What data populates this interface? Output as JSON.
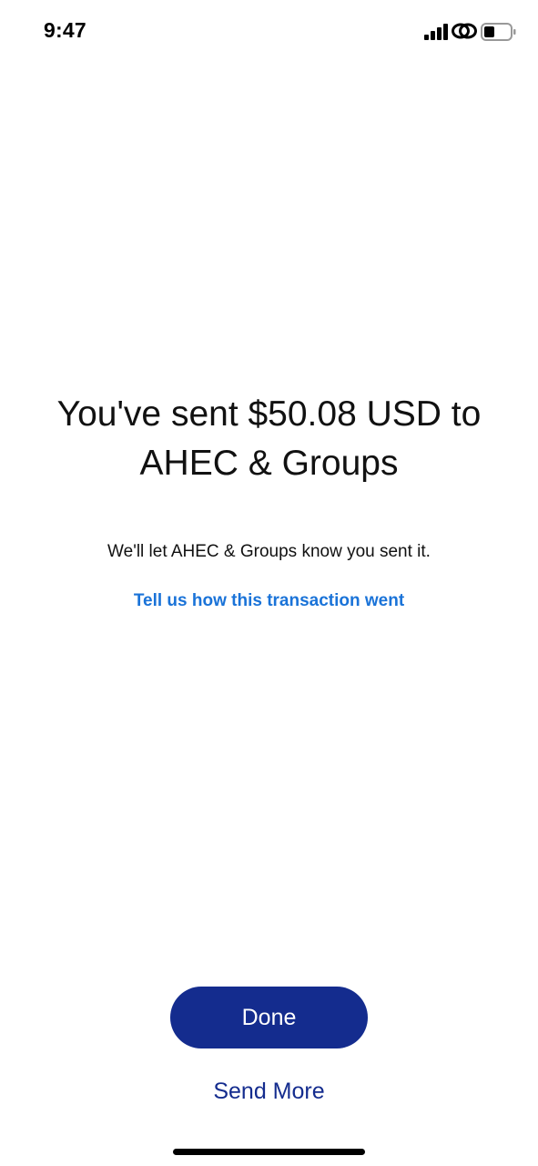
{
  "status_bar": {
    "time": "9:47",
    "icons": [
      "signal-icon",
      "link-icon",
      "battery-icon"
    ]
  },
  "confirmation": {
    "headline": "You've sent $50.08 USD to AHEC & Groups",
    "subtext": "We'll let AHEC & Groups know you sent it.",
    "feedback_link": "Tell us how this transaction went"
  },
  "actions": {
    "done_label": "Done",
    "send_more_label": "Send More"
  },
  "colors": {
    "primary": "#142c8e",
    "link": "#1a73d8",
    "text": "#111111",
    "background": "#ffffff"
  }
}
